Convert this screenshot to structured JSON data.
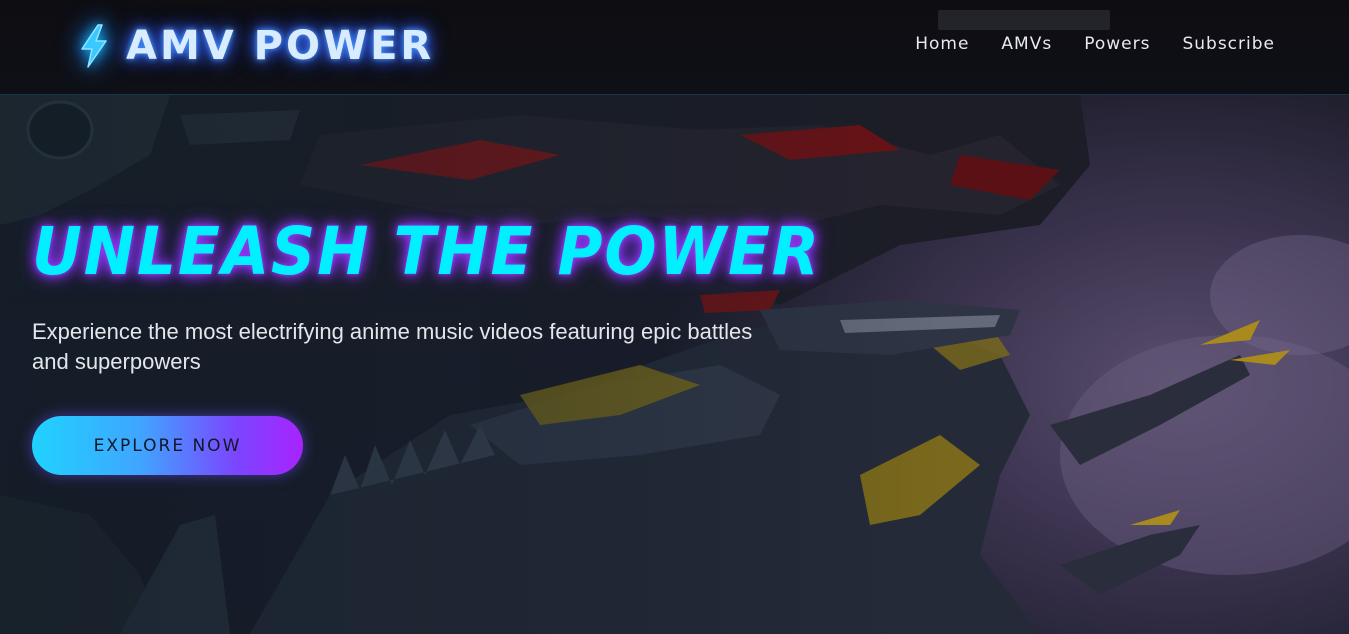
{
  "header": {
    "logo_text": "AMV POWER",
    "logo_icon": "lightning-bolt-icon",
    "nav": [
      {
        "label": "Home"
      },
      {
        "label": "AMVs"
      },
      {
        "label": "Powers"
      },
      {
        "label": "Subscribe"
      }
    ]
  },
  "hero": {
    "title": "UNLEASH THE POWER",
    "subtitle": "Experience the most electrifying anime music videos featuring epic battles and superpowers",
    "cta_label": "EXPLORE NOW",
    "background_image": "mecha-dragon-illustration"
  },
  "colors": {
    "accent_cyan": "#00f0ff",
    "accent_purple": "#a823ff",
    "logo_glow": "#3a6cff",
    "header_bg": "#0d0d12"
  }
}
